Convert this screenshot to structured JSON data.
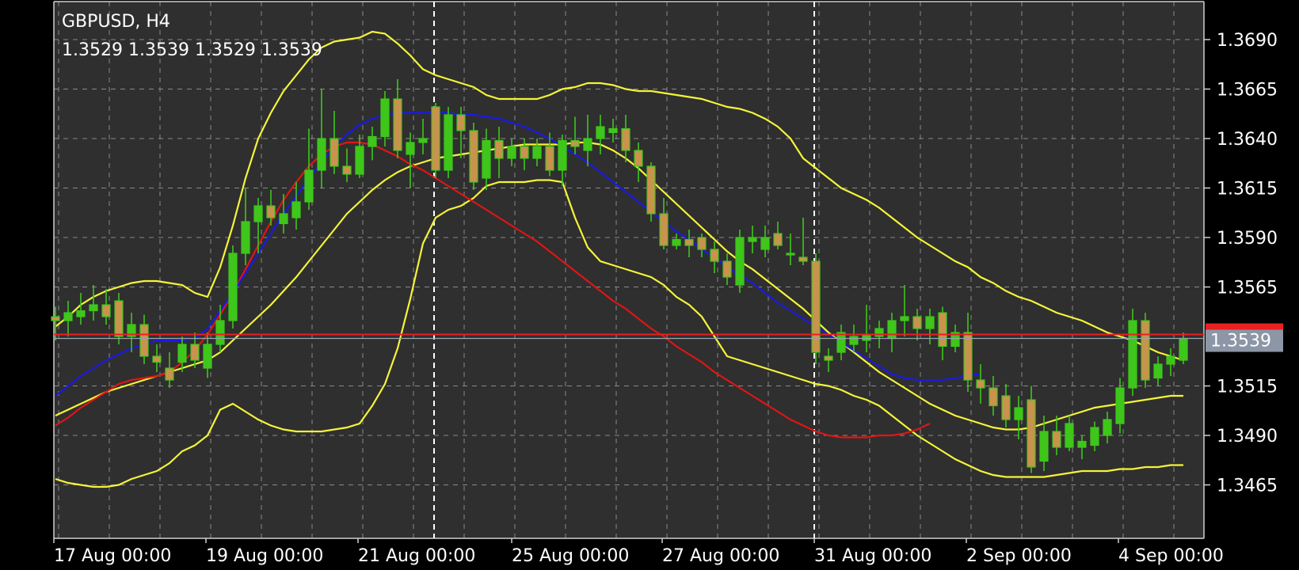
{
  "chart_data": {
    "type": "candlestick",
    "symbol_label": "GBPUSD, H4",
    "ohlc_readout": "1.3529 1.3539 1.3529 1.3539",
    "current_price": 1.3539,
    "current_price_label": "1.3539",
    "price_ticks": [
      {
        "value": 1.369,
        "label": "1.3690"
      },
      {
        "value": 1.3665,
        "label": "1.3665"
      },
      {
        "value": 1.364,
        "label": "1.3640"
      },
      {
        "value": 1.3615,
        "label": "1.3615"
      },
      {
        "value": 1.359,
        "label": "1.3590"
      },
      {
        "value": 1.3565,
        "label": "1.3565"
      },
      {
        "value": 1.3515,
        "label": "1.3515"
      },
      {
        "value": 1.349,
        "label": "1.3490"
      },
      {
        "value": 1.3465,
        "label": "1.3465"
      }
    ],
    "time_labels": [
      {
        "bar": 0,
        "label": "17 Aug 00:00"
      },
      {
        "bar": 12,
        "label": "19 Aug 00:00"
      },
      {
        "bar": 24,
        "label": "21 Aug 00:00"
      },
      {
        "bar": 36,
        "label": "25 Aug 00:00"
      },
      {
        "bar": 48,
        "label": "27 Aug 00:00"
      },
      {
        "bar": 60,
        "label": "31 Aug 00:00"
      },
      {
        "bar": 72,
        "label": "2 Sep 00:00"
      },
      {
        "bar": 84,
        "label": "4 Sep 00:00"
      }
    ],
    "week_separators": [
      30,
      60
    ],
    "y_range": [
      1.342,
      1.37
    ],
    "grid": true,
    "colors": {
      "background": "#2f2f2f",
      "grid": "#8a8a8a",
      "bull_candle": "#3ec61a",
      "bear_candle": "#c9934e",
      "bollinger": "#f4f43a",
      "ma_blue": "#1a1ae6",
      "ma_red": "#e01515",
      "current_price_line": "#e82020",
      "current_price_box": "#8c96a6"
    },
    "candles": [
      [
        1.355,
        1.3555,
        1.3538,
        1.3548
      ],
      [
        1.3548,
        1.3558,
        1.354,
        1.3552
      ],
      [
        1.355,
        1.3562,
        1.3546,
        1.3553
      ],
      [
        1.3553,
        1.3566,
        1.3548,
        1.3556
      ],
      [
        1.3556,
        1.3564,
        1.3546,
        1.355
      ],
      [
        1.3558,
        1.3562,
        1.3536,
        1.354
      ],
      [
        1.354,
        1.3552,
        1.3532,
        1.3546
      ],
      [
        1.3546,
        1.3551,
        1.3526,
        1.353
      ],
      [
        1.353,
        1.3536,
        1.3522,
        1.3527
      ],
      [
        1.3524,
        1.3532,
        1.3514,
        1.3518
      ],
      [
        1.3527,
        1.354,
        1.3522,
        1.3536
      ],
      [
        1.3536,
        1.3542,
        1.3524,
        1.3528
      ],
      [
        1.3524,
        1.3542,
        1.3519,
        1.3536
      ],
      [
        1.3536,
        1.3556,
        1.3532,
        1.3548
      ],
      [
        1.3548,
        1.3586,
        1.3544,
        1.3582
      ],
      [
        1.3582,
        1.3615,
        1.3576,
        1.3598
      ],
      [
        1.3598,
        1.361,
        1.3582,
        1.3606
      ],
      [
        1.3606,
        1.3614,
        1.3596,
        1.36
      ],
      [
        1.3597,
        1.3612,
        1.3592,
        1.3602
      ],
      [
        1.36,
        1.3618,
        1.3594,
        1.3608
      ],
      [
        1.3608,
        1.3645,
        1.3604,
        1.3624
      ],
      [
        1.3624,
        1.3665,
        1.3615,
        1.364
      ],
      [
        1.364,
        1.3654,
        1.3622,
        1.3626
      ],
      [
        1.3626,
        1.3635,
        1.3618,
        1.3622
      ],
      [
        1.3622,
        1.3642,
        1.362,
        1.3636
      ],
      [
        1.3636,
        1.3646,
        1.3629,
        1.3641
      ],
      [
        1.3641,
        1.3664,
        1.3636,
        1.366
      ],
      [
        1.366,
        1.367,
        1.363,
        1.3634
      ],
      [
        1.3632,
        1.3643,
        1.3615,
        1.3638
      ],
      [
        1.3638,
        1.365,
        1.3632,
        1.364
      ],
      [
        1.3656,
        1.3658,
        1.362,
        1.3624
      ],
      [
        1.3624,
        1.3656,
        1.362,
        1.3652
      ],
      [
        1.3652,
        1.3656,
        1.363,
        1.3644
      ],
      [
        1.3644,
        1.3648,
        1.3614,
        1.3618
      ],
      [
        1.362,
        1.3645,
        1.3614,
        1.3639
      ],
      [
        1.3639,
        1.3646,
        1.362,
        1.363
      ],
      [
        1.363,
        1.364,
        1.3626,
        1.3636
      ],
      [
        1.3636,
        1.364,
        1.3624,
        1.363
      ],
      [
        1.363,
        1.364,
        1.3626,
        1.3636
      ],
      [
        1.3636,
        1.3643,
        1.3621,
        1.3624
      ],
      [
        1.3624,
        1.3642,
        1.3616,
        1.3639
      ],
      [
        1.3639,
        1.3651,
        1.3632,
        1.3636
      ],
      [
        1.3634,
        1.3652,
        1.3626,
        1.364
      ],
      [
        1.364,
        1.3652,
        1.3632,
        1.3646
      ],
      [
        1.3643,
        1.365,
        1.3638,
        1.3645
      ],
      [
        1.3645,
        1.3652,
        1.3628,
        1.3634
      ],
      [
        1.3634,
        1.3638,
        1.3618,
        1.3626
      ],
      [
        1.3626,
        1.3628,
        1.3598,
        1.3602
      ],
      [
        1.3602,
        1.361,
        1.3584,
        1.3586
      ],
      [
        1.3586,
        1.3592,
        1.3584,
        1.3589
      ],
      [
        1.3589,
        1.3594,
        1.358,
        1.3586
      ],
      [
        1.359,
        1.3592,
        1.358,
        1.3584
      ],
      [
        1.3584,
        1.3588,
        1.3572,
        1.3578
      ],
      [
        1.3578,
        1.3582,
        1.3566,
        1.357
      ],
      [
        1.3566,
        1.3594,
        1.3562,
        1.359
      ],
      [
        1.3588,
        1.3596,
        1.3582,
        1.359
      ],
      [
        1.3584,
        1.3596,
        1.358,
        1.359
      ],
      [
        1.3592,
        1.3598,
        1.3584,
        1.3586
      ],
      [
        1.3582,
        1.3592,
        1.3576,
        1.3582
      ],
      [
        1.358,
        1.36,
        1.3576,
        1.3578
      ],
      [
        1.3578,
        1.3582,
        1.3526,
        1.3532
      ],
      [
        1.353,
        1.3534,
        1.3522,
        1.3528
      ],
      [
        1.3532,
        1.3546,
        1.3528,
        1.3542
      ],
      [
        1.3536,
        1.3546,
        1.3532,
        1.354
      ],
      [
        1.3538,
        1.3556,
        1.3532,
        1.3541
      ],
      [
        1.354,
        1.3548,
        1.3534,
        1.3544
      ],
      [
        1.3539,
        1.3552,
        1.3532,
        1.3548
      ],
      [
        1.3548,
        1.3566,
        1.354,
        1.355
      ],
      [
        1.355,
        1.3554,
        1.3538,
        1.3544
      ],
      [
        1.3544,
        1.3554,
        1.3536,
        1.355
      ],
      [
        1.3552,
        1.3555,
        1.3528,
        1.3535
      ],
      [
        1.3535,
        1.3546,
        1.3532,
        1.3542
      ],
      [
        1.3542,
        1.3552,
        1.3512,
        1.3518
      ],
      [
        1.3518,
        1.3526,
        1.3506,
        1.3514
      ],
      [
        1.3514,
        1.352,
        1.35,
        1.3505
      ],
      [
        1.351,
        1.3516,
        1.3494,
        1.3498
      ],
      [
        1.3498,
        1.351,
        1.3488,
        1.3504
      ],
      [
        1.3508,
        1.3515,
        1.3471,
        1.3474
      ],
      [
        1.3477,
        1.35,
        1.3472,
        1.3492
      ],
      [
        1.3492,
        1.35,
        1.348,
        1.3484
      ],
      [
        1.3484,
        1.35,
        1.3482,
        1.3496
      ],
      [
        1.3484,
        1.349,
        1.3478,
        1.3487
      ],
      [
        1.3485,
        1.3497,
        1.3482,
        1.3494
      ],
      [
        1.349,
        1.3502,
        1.3486,
        1.3498
      ],
      [
        1.3496,
        1.3519,
        1.3491,
        1.3514
      ],
      [
        1.3514,
        1.3554,
        1.351,
        1.3548
      ],
      [
        1.3548,
        1.3552,
        1.3514,
        1.3518
      ],
      [
        1.3519,
        1.353,
        1.3515,
        1.3526
      ],
      [
        1.3526,
        1.3534,
        1.352,
        1.353
      ],
      [
        1.3528,
        1.3542,
        1.3526,
        1.3539
      ]
    ],
    "bollinger_upper": [
      1.3545,
      1.355,
      1.3556,
      1.356,
      1.3563,
      1.3565,
      1.3567,
      1.3568,
      1.3568,
      1.3567,
      1.3566,
      1.3562,
      1.356,
      1.3575,
      1.3596,
      1.362,
      1.364,
      1.3653,
      1.3664,
      1.3672,
      1.368,
      1.3686,
      1.3689,
      1.369,
      1.3691,
      1.3694,
      1.3693,
      1.3688,
      1.3682,
      1.3675,
      1.3672,
      1.367,
      1.3668,
      1.3666,
      1.3662,
      1.366,
      1.366,
      1.366,
      1.366,
      1.3662,
      1.3665,
      1.3666,
      1.3668,
      1.3668,
      1.3667,
      1.3665,
      1.3664,
      1.3664,
      1.3663,
      1.3662,
      1.3661,
      1.366,
      1.3658,
      1.3656,
      1.3655,
      1.3653,
      1.365,
      1.3646,
      1.364,
      1.363,
      1.3625,
      1.362,
      1.3615,
      1.3612,
      1.3609,
      1.3605,
      1.36,
      1.3595,
      1.359,
      1.3586,
      1.3582,
      1.3578,
      1.3575,
      1.357,
      1.3567,
      1.3563,
      1.356,
      1.3558,
      1.3555,
      1.3552,
      1.355,
      1.3548,
      1.3545,
      1.3542,
      1.354,
      1.3538,
      1.3535,
      1.3532,
      1.353,
      1.3528
    ],
    "bollinger_middle": [
      1.35,
      1.3503,
      1.3506,
      1.3509,
      1.3512,
      1.3514,
      1.3516,
      1.3518,
      1.352,
      1.3522,
      1.3524,
      1.3526,
      1.3528,
      1.3532,
      1.3538,
      1.3544,
      1.355,
      1.3556,
      1.3563,
      1.357,
      1.3578,
      1.3586,
      1.3594,
      1.3602,
      1.3608,
      1.3614,
      1.3619,
      1.3623,
      1.3626,
      1.3628,
      1.363,
      1.3631,
      1.3632,
      1.3633,
      1.3634,
      1.3635,
      1.3636,
      1.3637,
      1.3637,
      1.3637,
      1.3637,
      1.3638,
      1.3638,
      1.3637,
      1.3634,
      1.363,
      1.3625,
      1.3619,
      1.3613,
      1.3607,
      1.3601,
      1.3595,
      1.3589,
      1.3583,
      1.3578,
      1.3574,
      1.3569,
      1.3564,
      1.3559,
      1.3554,
      1.3548,
      1.3542,
      1.3537,
      1.3532,
      1.3527,
      1.3522,
      1.3518,
      1.3514,
      1.351,
      1.3506,
      1.3503,
      1.35,
      1.3498,
      1.3496,
      1.3494,
      1.3493,
      1.3493,
      1.3494,
      1.3496,
      1.3498,
      1.35,
      1.3502,
      1.3504,
      1.3505,
      1.3506,
      1.3507,
      1.3508,
      1.3509,
      1.351,
      1.351
    ],
    "bollinger_lower": [
      1.3468,
      1.3466,
      1.3465,
      1.3464,
      1.3464,
      1.3465,
      1.3468,
      1.347,
      1.3472,
      1.3476,
      1.3482,
      1.3485,
      1.349,
      1.3503,
      1.3506,
      1.3502,
      1.3498,
      1.3495,
      1.3493,
      1.3492,
      1.3492,
      1.3492,
      1.3493,
      1.3494,
      1.3496,
      1.3505,
      1.3516,
      1.3534,
      1.3559,
      1.3587,
      1.36,
      1.3604,
      1.3606,
      1.361,
      1.3616,
      1.3618,
      1.3618,
      1.3618,
      1.3619,
      1.3619,
      1.3618,
      1.36,
      1.3585,
      1.3578,
      1.3576,
      1.3574,
      1.3572,
      1.357,
      1.3566,
      1.356,
      1.3556,
      1.355,
      1.354,
      1.353,
      1.3528,
      1.3526,
      1.3524,
      1.3522,
      1.352,
      1.3518,
      1.3516,
      1.3515,
      1.3513,
      1.351,
      1.3508,
      1.3505,
      1.35,
      1.3495,
      1.349,
      1.3486,
      1.3482,
      1.3478,
      1.3475,
      1.3472,
      1.347,
      1.3469,
      1.3469,
      1.3469,
      1.3469,
      1.347,
      1.3471,
      1.3472,
      1.3472,
      1.3472,
      1.3473,
      1.3473,
      1.3474,
      1.3474,
      1.3475,
      1.3475
    ],
    "ma_blue": [
      1.351,
      1.3515,
      1.352,
      1.3524,
      1.3528,
      1.3531,
      1.3534,
      1.3536,
      1.3538,
      1.3538,
      1.3538,
      1.3539,
      1.3544,
      1.3553,
      1.3562,
      1.3572,
      1.3582,
      1.3592,
      1.3602,
      1.3611,
      1.362,
      1.3628,
      1.3636,
      1.3642,
      1.3647,
      1.365,
      1.3652,
      1.3653,
      1.3653,
      1.3653,
      1.3653,
      1.3653,
      1.3652,
      1.3652,
      1.3651,
      1.365,
      1.3648,
      1.3646,
      1.3643,
      1.364,
      1.3636,
      1.3632,
      1.3628,
      1.3623,
      1.3618,
      1.3613,
      1.3608,
      1.3603,
      1.3598,
      1.3593,
      1.3589,
      1.3584,
      1.358,
      1.3575,
      1.3571,
      1.3567,
      1.3562,
      1.3557,
      1.3553,
      1.3549,
      1.3545,
      1.3541,
      1.3537,
      1.3533,
      1.3529,
      1.3525,
      1.3521,
      1.3519,
      1.3518,
      1.3518,
      1.3518,
      1.3519,
      1.352,
      1.3521
    ],
    "ma_red": [
      1.3495,
      1.3499,
      1.3504,
      1.3508,
      1.3512,
      1.3516,
      1.3518,
      1.3519,
      1.352,
      1.3522,
      1.3527,
      1.3533,
      1.3541,
      1.3551,
      1.3562,
      1.3574,
      1.3586,
      1.3598,
      1.3609,
      1.3618,
      1.3626,
      1.3632,
      1.3636,
      1.3638,
      1.3638,
      1.3637,
      1.3634,
      1.3631,
      1.3627,
      1.3624,
      1.362,
      1.3616,
      1.3612,
      1.3608,
      1.3604,
      1.36,
      1.3596,
      1.3592,
      1.3588,
      1.3583,
      1.3578,
      1.3573,
      1.3568,
      1.3563,
      1.3558,
      1.3554,
      1.3549,
      1.3544,
      1.354,
      1.3535,
      1.3531,
      1.3527,
      1.3522,
      1.3518,
      1.3514,
      1.351,
      1.3506,
      1.3502,
      1.3498,
      1.3495,
      1.3492,
      1.349,
      1.3489,
      1.3489,
      1.3489,
      1.349,
      1.349,
      1.3491,
      1.3493,
      1.3496
    ]
  }
}
